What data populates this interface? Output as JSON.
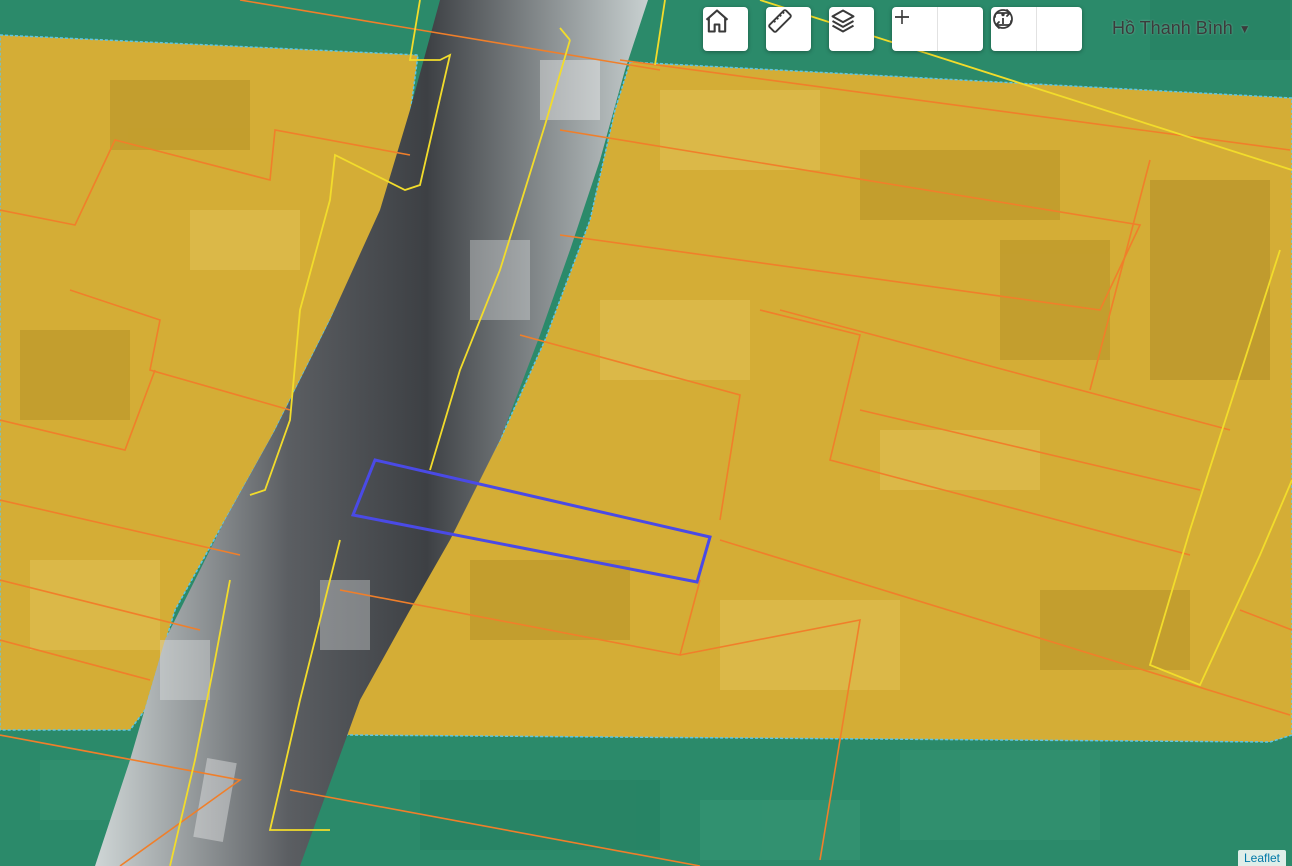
{
  "toolbar": {
    "home_icon": "home-icon",
    "ruler_icon": "ruler-icon",
    "layers_icon": "layers-icon",
    "zoom_in_icon": "plus-icon",
    "zoom_out_icon": "minus-icon",
    "info_icon": "info-icon",
    "swap_icon": "swap-icon"
  },
  "user": {
    "name": "Hồ Thanh Bình"
  },
  "attribution": {
    "label": "Leaflet"
  },
  "colors": {
    "residential_zone": "#d4ad36",
    "green_zone": "#2b8a6a",
    "parcel_line": "#f07f2a",
    "road_line": "#f2dc2b",
    "selected_parcel": "#4a4ae6",
    "zone_border": "#5ec6e8"
  }
}
